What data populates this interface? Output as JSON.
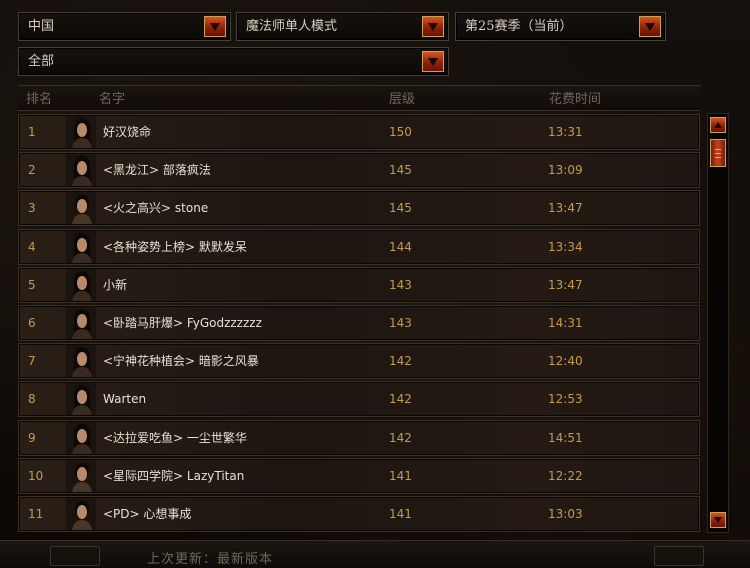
{
  "filters": {
    "region": "中国",
    "mode": "魔法师单人模式",
    "season": "第25赛季（当前）",
    "class": "全部"
  },
  "table": {
    "headers": {
      "rank": "排名",
      "name": "名字",
      "level": "层级",
      "time": "花费时间"
    },
    "rows": [
      {
        "rank": "1",
        "name": "好汉饶命",
        "level": "150",
        "time": "13:31",
        "portrait": "female"
      },
      {
        "rank": "2",
        "name": "<黑龙江> 部落疯法",
        "level": "145",
        "time": "13:09",
        "portrait": "female"
      },
      {
        "rank": "3",
        "name": "<火之高兴> stone",
        "level": "145",
        "time": "13:47",
        "portrait": "male"
      },
      {
        "rank": "4",
        "name": "<各种姿势上榜> 默默发呆",
        "level": "144",
        "time": "13:34",
        "portrait": "female"
      },
      {
        "rank": "5",
        "name": "小新",
        "level": "143",
        "time": "13:47",
        "portrait": "female"
      },
      {
        "rank": "6",
        "name": "<卧踏马肝爆> FyGodzzzzzz",
        "level": "143",
        "time": "14:31",
        "portrait": "female"
      },
      {
        "rank": "7",
        "name": "<宁神花种植会> 暗影之风暴",
        "level": "142",
        "time": "12:40",
        "portrait": "female"
      },
      {
        "rank": "8",
        "name": "Warten",
        "level": "142",
        "time": "12:53",
        "portrait": "female"
      },
      {
        "rank": "9",
        "name": "<达拉爱吃鱼> 一尘世繁华",
        "level": "142",
        "time": "14:51",
        "portrait": "female"
      },
      {
        "rank": "10",
        "name": "<星际四学院> LazyTitan",
        "level": "141",
        "time": "12:22",
        "portrait": "male"
      },
      {
        "rank": "11",
        "name": "<PD> 心想事成",
        "level": "141",
        "time": "13:03",
        "portrait": "male"
      }
    ]
  },
  "footer": {
    "last_update": "上次更新：最新版本"
  },
  "colors": {
    "accent": "#c9a05a",
    "button": "#b8401a",
    "rank_text": "#c49a52",
    "name_text": "#e6e0d4"
  },
  "icons": {
    "dropdown": "chevron-down-icon",
    "scroll_up": "arrow-up-icon",
    "scroll_down": "arrow-down-icon"
  }
}
